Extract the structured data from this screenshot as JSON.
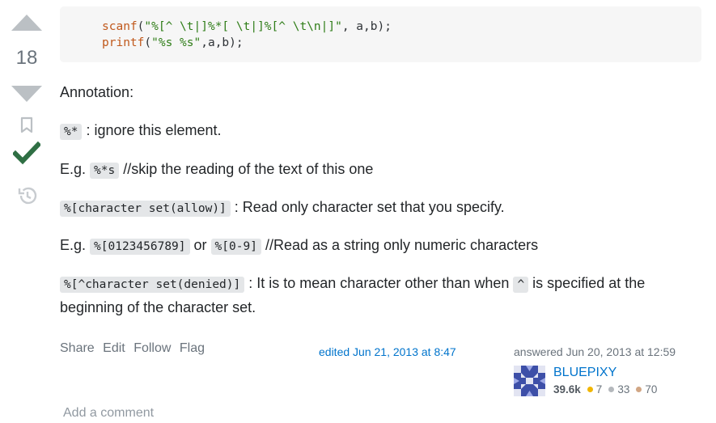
{
  "votes": {
    "count": "18"
  },
  "code": {
    "line1_fn": "scanf",
    "line1_open": "(",
    "line1_str": "\"%[^ \\t|]%*[ \\t|]%[^ \\t\\n|]\"",
    "line1_rest": ", a,b);",
    "line2_fn": "printf",
    "line2_open": "(",
    "line2_str": "\"%s %s\"",
    "line2_rest": ",a,b);"
  },
  "body": {
    "annotation_title": "Annotation:",
    "p1_code": "%*",
    "p1_text": " : ignore this element.",
    "p2_prefix": "E.g. ",
    "p2_code": "%*s",
    "p2_text": " //skip the reading of the text of this one",
    "p3_code": "%[character set(allow)]",
    "p3_text": " : Read only character set that you specify.",
    "p4_prefix": "E.g. ",
    "p4_code1": "%[0123456789]",
    "p4_or": " or ",
    "p4_code2": "%[0-9]",
    "p4_text": " //Read as a string only numeric characters",
    "p5_code1": "%[^character set(denied)]",
    "p5_text1": " : It is to mean character other than when ",
    "p5_code2": "^",
    "p5_text2": " is specified at the beginning of the character set."
  },
  "menu": {
    "share": "Share",
    "edit": "Edit",
    "follow": "Follow",
    "flag": "Flag"
  },
  "edited": "edited Jun 21, 2013 at 8:47",
  "answered": "answered Jun 20, 2013 at 12:59",
  "user": {
    "name": "BLUEPIXY",
    "reputation": "39.6k",
    "gold": "7",
    "silver": "33",
    "bronze": "70",
    "badge_colors": {
      "gold": "#f1b600",
      "silver": "#b4b8bc",
      "bronze": "#d1a684"
    }
  },
  "comment": {
    "add_label": "Add a comment"
  },
  "colors": {
    "accepted": "#2f6f44",
    "link": "#0074cc",
    "vote_arrow": "#bbc0c4"
  },
  "icons": [
    "upvote-icon",
    "downvote-icon",
    "bookmark-icon",
    "accepted-checkmark-icon",
    "history-icon"
  ]
}
